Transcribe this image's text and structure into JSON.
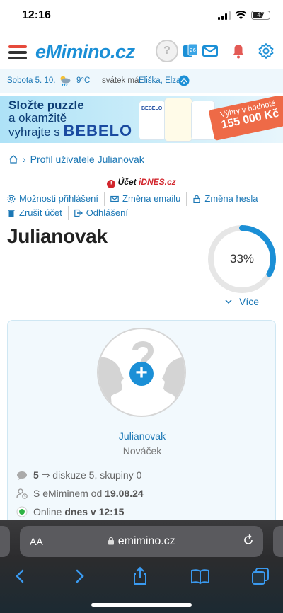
{
  "status_bar": {
    "time": "12:16",
    "battery": "47"
  },
  "header": {
    "logo": "eMimino.cz",
    "avatar_glyph": "?"
  },
  "info_bar": {
    "date": "Sobota 5. 10.",
    "temperature": "9°C",
    "nameday_label": "svátek má:",
    "nameday_names": "Eliška, Elza"
  },
  "banner": {
    "line1": "Složte puzzle",
    "line2": "a okamžitě",
    "line3": "vyhrajte s",
    "brand": "BEBELO",
    "prize_line1": "Výhry v hodnotě",
    "prize_line2": "155 000 Kč",
    "product_label": "BEBELO"
  },
  "breadcrumb": {
    "label": "Profil uživatele Julianovak"
  },
  "idnes": {
    "account": "Účet",
    "brand": "iDNES.cz"
  },
  "account_links": {
    "login_options": "Možnosti přihlášení",
    "change_email": "Změna emailu",
    "change_password": "Změna hesla",
    "cancel_account": "Zrušit účet",
    "logout": "Odhlášení"
  },
  "profile": {
    "username": "Julianovak",
    "completion_percent": 33,
    "completion_label": "33%",
    "more_label": "Více"
  },
  "card": {
    "name": "Julianovak",
    "rank": "Nováček",
    "discussions_count": "5",
    "discussions_detail": "⇒ diskuze 5, skupiny 0",
    "member_since_label": "S eMiminem od",
    "member_since_date": "19.08.24",
    "online_label": "Online",
    "online_time": "dnes v 12:15"
  },
  "browser": {
    "aa": "AA",
    "url": "emimino.cz"
  },
  "colors": {
    "accent": "#1b8fd6",
    "link": "#1b77b5",
    "brand_red": "#d2262d"
  }
}
